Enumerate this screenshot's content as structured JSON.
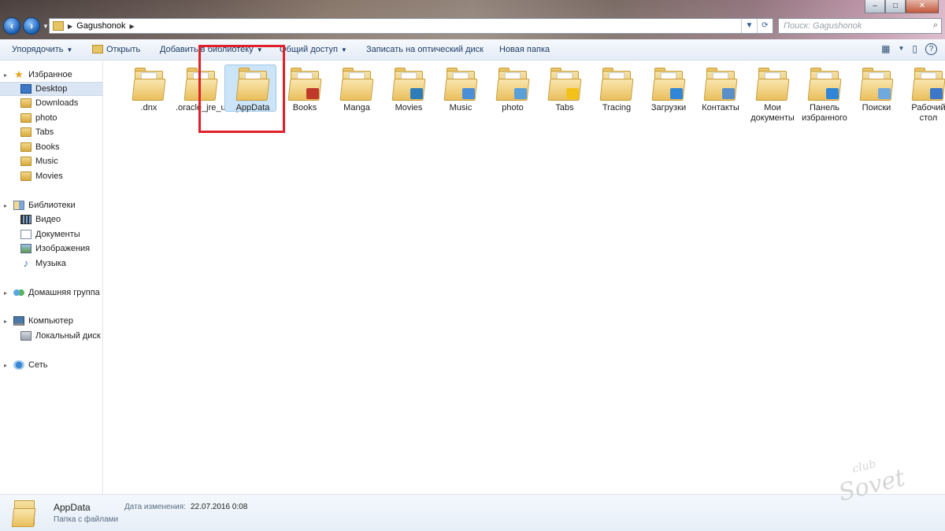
{
  "window": {
    "controls": [
      "–",
      "□",
      "✕"
    ]
  },
  "address": {
    "crumb": "Gagushonok",
    "search_placeholder": "Поиск: Gagushonok"
  },
  "toolbar": {
    "organize": "Упорядочить",
    "open": "Открыть",
    "add_to_library": "Добавить в библиотеку",
    "share": "Общий доступ",
    "burn": "Записать на оптический диск",
    "new_folder": "Новая папка"
  },
  "sidebar": {
    "favorites": {
      "label": "Избранное",
      "items": [
        {
          "label": "Desktop",
          "icon": "desktop-icon"
        },
        {
          "label": "Downloads",
          "icon": "folder-icon"
        },
        {
          "label": "photo",
          "icon": "folder-icon"
        },
        {
          "label": "Tabs",
          "icon": "folder-icon"
        },
        {
          "label": "Books",
          "icon": "folder-icon"
        },
        {
          "label": "Music",
          "icon": "folder-icon"
        },
        {
          "label": "Movies",
          "icon": "folder-icon"
        }
      ]
    },
    "libraries": {
      "label": "Библиотеки",
      "items": [
        {
          "label": "Видео",
          "icon": "video-library-icon"
        },
        {
          "label": "Документы",
          "icon": "documents-library-icon"
        },
        {
          "label": "Изображения",
          "icon": "pictures-library-icon"
        },
        {
          "label": "Музыка",
          "icon": "music-library-icon"
        }
      ]
    },
    "homegroup": {
      "label": "Домашняя группа"
    },
    "computer": {
      "label": "Компьютер",
      "items": [
        {
          "label": "Локальный диск (",
          "icon": "hard-disk-icon"
        }
      ]
    },
    "network": {
      "label": "Сеть"
    }
  },
  "files": [
    {
      "name": ".dnx",
      "badge": ""
    },
    {
      "name": ".oracle_jre_usage",
      "badge": ""
    },
    {
      "name": "AppData",
      "badge": "",
      "selected": true
    },
    {
      "name": "Books",
      "badge": "#c0392b"
    },
    {
      "name": "Manga",
      "badge": ""
    },
    {
      "name": "Movies",
      "badge": "#2e7db8"
    },
    {
      "name": "Music",
      "badge": "#4b8fd6"
    },
    {
      "name": "photo",
      "badge": "#5aa0d8"
    },
    {
      "name": "Tabs",
      "badge": "#f2c21b"
    },
    {
      "name": "Tracing",
      "badge": ""
    },
    {
      "name": "Загрузки",
      "badge": "#2f86d6"
    },
    {
      "name": "Контакты",
      "badge": "#5a8fc8"
    },
    {
      "name": "Мои документы",
      "badge": ""
    },
    {
      "name": "Панель избранного",
      "badge": "#2f86d6"
    },
    {
      "name": "Поиски",
      "badge": "#6fa9de"
    },
    {
      "name": "Рабочий стол",
      "badge": "#3c77c8"
    }
  ],
  "details": {
    "name": "AppData",
    "type": "Папка с файлами",
    "modified_label": "Дата изменения:",
    "modified_value": "22.07.2016 0:08"
  },
  "watermark": {
    "line1": "Sovet",
    "line2": "club"
  },
  "colors": {
    "highlight_box": "#e0202a",
    "selection": "#cce4f7",
    "command_text": "#1e3c64"
  }
}
